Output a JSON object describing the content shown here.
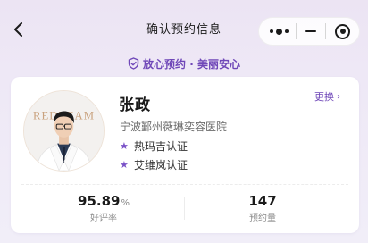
{
  "nav": {
    "title": "确认预约信息",
    "back_icon": "chevron-left-icon"
  },
  "capsule": {
    "more_icon": "more-dots-icon",
    "minimize_icon": "minimize-icon",
    "close_icon": "close-circle-icon"
  },
  "trust": {
    "icon": "shield-check-icon",
    "text": "放心预约 · 美丽安心",
    "color": "#6f47b8"
  },
  "doctor": {
    "name": "张政",
    "hospital": "宁波鄞州薇琳奕容医院",
    "switch_label": "更换",
    "avatar_logo_text": "REDREAM",
    "certifications": [
      {
        "icon": "star-icon",
        "label": "热玛吉认证"
      },
      {
        "icon": "star-icon",
        "label": "艾维岚认证"
      }
    ],
    "stats": [
      {
        "value": "95.89",
        "unit": "%",
        "label": "好评率"
      },
      {
        "value": "147",
        "unit": "",
        "label": "预约量"
      }
    ]
  }
}
